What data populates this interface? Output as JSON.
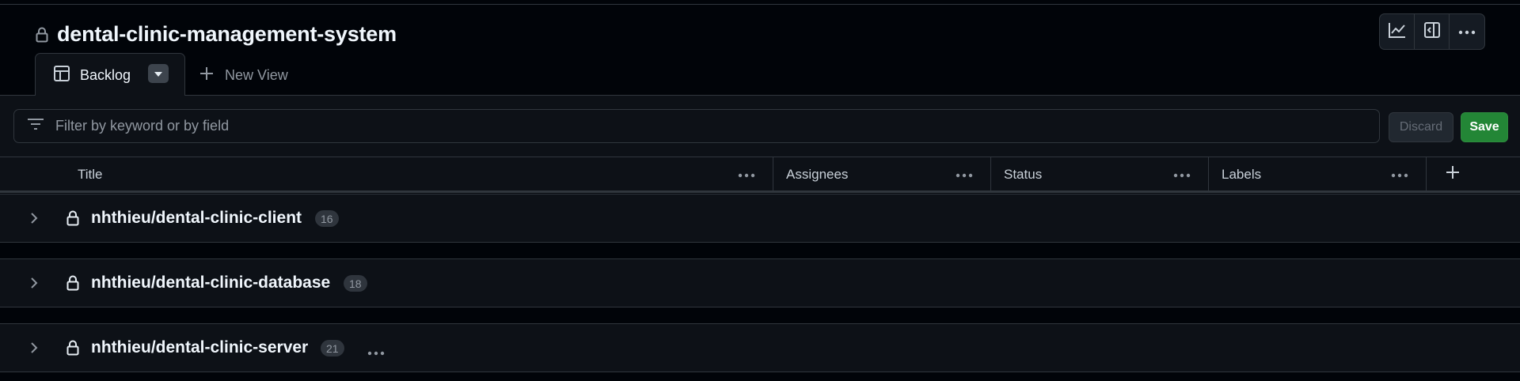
{
  "project": {
    "title": "dental-clinic-management-system"
  },
  "toolbar": {
    "buttons": [
      "insights-icon",
      "sidebar-panel-icon",
      "more-options-icon"
    ]
  },
  "tabs": {
    "active_label": "Backlog",
    "new_view_label": "New View"
  },
  "filter": {
    "placeholder": "Filter by keyword or by field",
    "discard_label": "Discard",
    "save_label": "Save"
  },
  "columns": {
    "title": "Title",
    "assignees": "Assignees",
    "status": "Status",
    "labels": "Labels"
  },
  "groups": [
    {
      "name": "nhthieu/dental-clinic-client",
      "count": "16"
    },
    {
      "name": "nhthieu/dental-clinic-database",
      "count": "18"
    },
    {
      "name": "nhthieu/dental-clinic-server",
      "count": "21"
    }
  ],
  "colors": {
    "background": "#010409",
    "surface": "#0d1117",
    "border": "#30363d",
    "save_green": "#238636"
  }
}
